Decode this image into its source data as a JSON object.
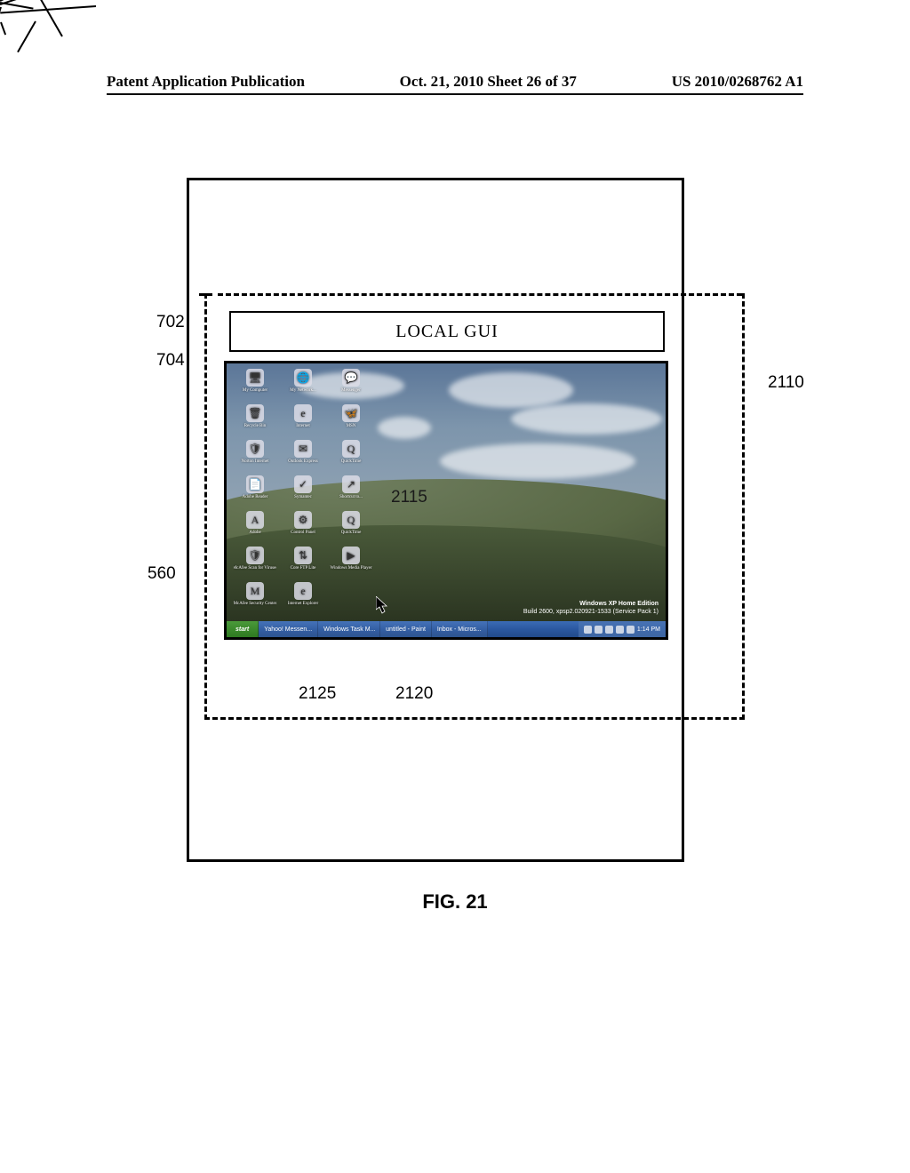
{
  "header": {
    "left": "Patent Application Publication",
    "center": "Oct. 21, 2010   Sheet 26 of 37",
    "right": "US 2010/0268762 A1"
  },
  "local_gui_label": "LOCAL GUI",
  "os_label": {
    "line1": "Windows XP Home Edition",
    "line2": "Build 2600, xpsp2.020921-1533 (Service Pack 1)"
  },
  "taskbar": {
    "start": "start",
    "items": [
      "Yahoo! Messen...",
      "Windows Task M...",
      "untitled - Paint",
      "Inbox - Micros..."
    ],
    "time": "1:14 PM"
  },
  "desktop_icons": [
    [
      "My Computer",
      "My Network...",
      "Messenger"
    ],
    [
      "Recycle Bin",
      "Internet",
      "MSN"
    ],
    [
      "Norton Internet",
      "Outlook Express",
      "QuickTime"
    ],
    [
      "Adobe Reader",
      "Symantec",
      "Shortcut to..."
    ],
    [
      "Adobe",
      "Control Panel",
      "QuickTime"
    ],
    [
      "McAfee Scan for Viruses",
      "Core FTP Lite",
      "Windows Media Player"
    ],
    [
      "McAfee Security Center",
      "Internet Explorer",
      ""
    ]
  ],
  "refs": {
    "r702": "702",
    "r704": "704",
    "r560": "560",
    "r2110": "2110",
    "r2115": "2115",
    "r2125": "2125",
    "r2120": "2120"
  },
  "figure_caption": "FIG. 21"
}
